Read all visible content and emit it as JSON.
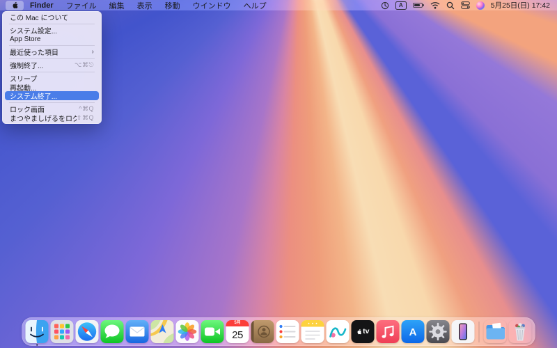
{
  "colors": {
    "menu_highlight": "#4a7de8",
    "calendar_red": "#fc3d39",
    "menubar_text": "#1a1a1c"
  },
  "menu_bar": {
    "apple_logo": "apple-logo-icon",
    "menus": [
      "Finder",
      "ファイル",
      "編集",
      "表示",
      "移動",
      "ウインドウ",
      "ヘルプ"
    ],
    "active_app": "Finder",
    "status": {
      "icons": [
        "clock-icon",
        "input-source-icon",
        "battery-icon",
        "wifi-icon",
        "spotlight-icon",
        "control-center-icon",
        "siri-icon"
      ],
      "input_source_label": "A",
      "datetime": "5月25日(日) 17:42"
    }
  },
  "apple_menu": {
    "items": [
      {
        "type": "item",
        "label": "この Mac について"
      },
      {
        "type": "separator"
      },
      {
        "type": "item",
        "label": "システム設定..."
      },
      {
        "type": "item",
        "label": "App Store"
      },
      {
        "type": "separator"
      },
      {
        "type": "item",
        "label": "最近使った項目",
        "submenu": true
      },
      {
        "type": "separator"
      },
      {
        "type": "item",
        "label": "強制終了...",
        "shortcut": "⌥⌘⎋"
      },
      {
        "type": "separator"
      },
      {
        "type": "item",
        "label": "スリープ"
      },
      {
        "type": "item",
        "label": "再起動..."
      },
      {
        "type": "item",
        "label": "システム終了...",
        "highlighted": true
      },
      {
        "type": "separator"
      },
      {
        "type": "item",
        "label": "ロック画面",
        "shortcut": "^⌘Q"
      },
      {
        "type": "item",
        "label": "まつやましげるをログアウト...",
        "shortcut": "⇧⌘Q"
      }
    ]
  },
  "dock": {
    "apps": [
      {
        "icon": "finder-icon",
        "running": true
      },
      {
        "icon": "launchpad-icon"
      },
      {
        "icon": "safari-icon"
      },
      {
        "icon": "messages-icon"
      },
      {
        "icon": "mail-icon"
      },
      {
        "icon": "maps-icon"
      },
      {
        "icon": "photos-icon"
      },
      {
        "icon": "facetime-icon"
      },
      {
        "icon": "calendar-icon"
      },
      {
        "icon": "contacts-icon"
      },
      {
        "icon": "reminders-icon"
      },
      {
        "icon": "notes-icon"
      },
      {
        "icon": "freeform-icon"
      },
      {
        "icon": "apple-tv-icon"
      },
      {
        "icon": "music-icon"
      },
      {
        "icon": "app-store-icon"
      },
      {
        "icon": "system-settings-icon"
      },
      {
        "icon": "iphone-mirroring-icon"
      },
      {
        "icon": "divider"
      },
      {
        "icon": "downloads-folder-icon"
      },
      {
        "icon": "trash-full-icon"
      }
    ],
    "calendar": {
      "month": "5月",
      "day": "25"
    },
    "apple_tv_text": "tv",
    "app_store_letter": "A"
  }
}
